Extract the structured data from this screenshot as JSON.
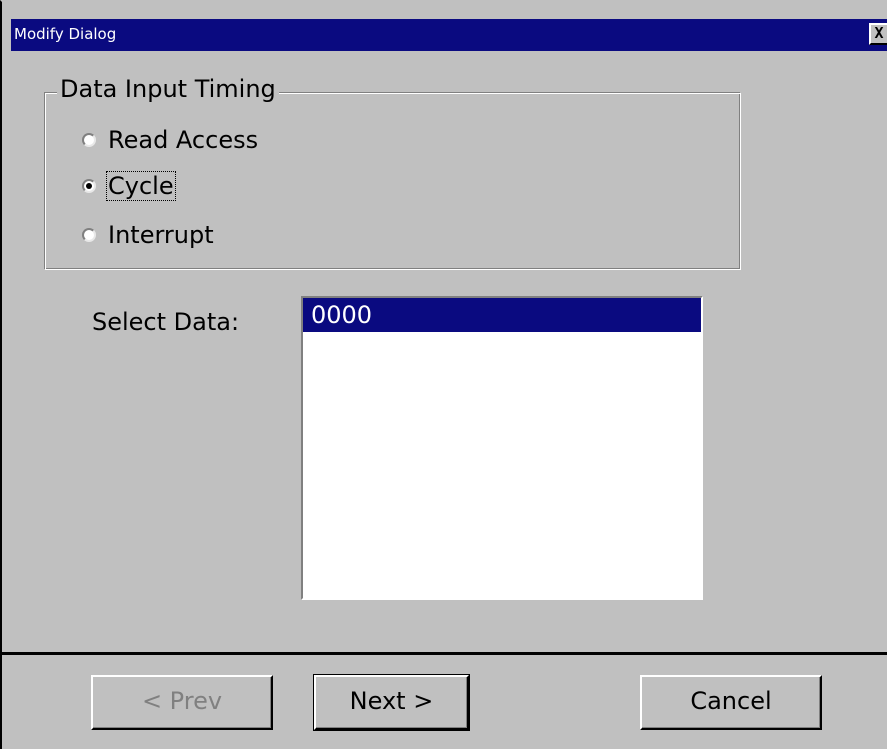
{
  "window": {
    "title": "Modify Dialog",
    "close_label": "X"
  },
  "group": {
    "legend": "Data Input Timing",
    "options": [
      {
        "label": "Read Access",
        "checked": false
      },
      {
        "label": "Cycle",
        "checked": true
      },
      {
        "label": "Interrupt",
        "checked": false
      }
    ]
  },
  "select_data": {
    "label": "Select Data:",
    "items": [
      "0000"
    ],
    "selected": "0000"
  },
  "buttons": {
    "prev": "< Prev",
    "next": "Next >",
    "cancel": "Cancel"
  },
  "colors": {
    "titlebar": "#0a0a80",
    "face": "#c0c0c0",
    "selection": "#0a0a80"
  }
}
